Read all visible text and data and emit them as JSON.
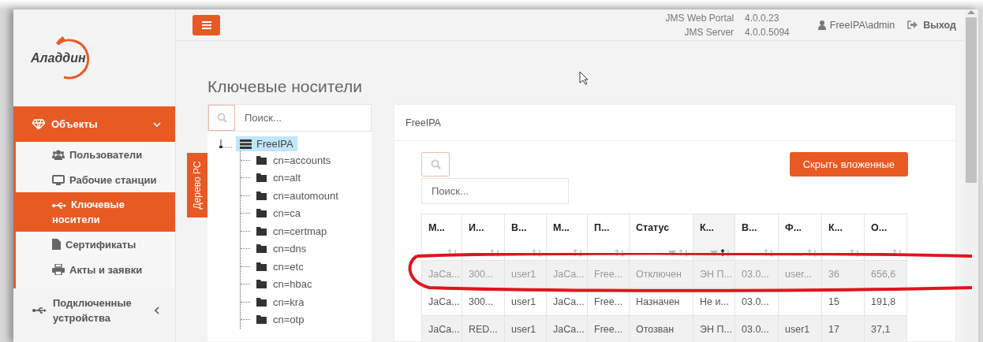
{
  "sidebar": {
    "logo": "Аладдин",
    "menu": [
      {
        "label": "Объекты",
        "expanded": true,
        "selected": true,
        "children": [
          {
            "label": "Пользователи",
            "selected": false
          },
          {
            "label": "Рабочие станции",
            "selected": false
          },
          {
            "label": "Ключевые носители",
            "selected": true
          },
          {
            "label": "Сертификаты",
            "selected": false
          },
          {
            "label": "Акты и заявки",
            "selected": false
          }
        ]
      },
      {
        "label": "Подключенные устройства",
        "expanded": false,
        "selected": false
      }
    ]
  },
  "topbar": {
    "versions": [
      {
        "name": "JMS Web Portal",
        "value": "4.0.0.23"
      },
      {
        "name": "JMS Server",
        "value": "4.0.0.5094"
      }
    ],
    "user": "FreeIPA\\admin",
    "logout": "Выход"
  },
  "page_title": "Ключевые носители",
  "tree_tab": "Дерево РС",
  "tree_search": {
    "placeholder": "Поиск..."
  },
  "tree": {
    "label": "FreeIPA",
    "selected": true,
    "expanded": true,
    "children": [
      {
        "label": "cn=accounts"
      },
      {
        "label": "cn=alt"
      },
      {
        "label": "cn=automount"
      },
      {
        "label": "cn=ca"
      },
      {
        "label": "cn=certmap"
      },
      {
        "label": "cn=dns"
      },
      {
        "label": "cn=etc"
      },
      {
        "label": "cn=hbac"
      },
      {
        "label": "cn=kra"
      },
      {
        "label": "cn=otp"
      }
    ]
  },
  "card": {
    "title": "FreeIPA",
    "search": {
      "placeholder": "Поиск..."
    },
    "hide_button": "Скрыть вложенные",
    "table": {
      "columns": [
        {
          "label": "М...",
          "sorted": false,
          "filter": false
        },
        {
          "label": "И...",
          "sorted": false,
          "filter": false
        },
        {
          "label": "В...",
          "sorted": false,
          "filter": false
        },
        {
          "label": "М...",
          "sorted": false,
          "filter": false
        },
        {
          "label": "П...",
          "sorted": false,
          "filter": false
        },
        {
          "label": "Статус",
          "sorted": false,
          "filter": true
        },
        {
          "label": "К...",
          "sorted": true,
          "filter": true
        },
        {
          "label": "В...",
          "sorted": false,
          "filter": false
        },
        {
          "label": "Ф...",
          "sorted": false,
          "filter": false
        },
        {
          "label": "К...",
          "sorted": false,
          "filter": false
        },
        {
          "label": "О...",
          "sorted": false,
          "filter": false
        }
      ],
      "rows": [
        {
          "disabled": true,
          "cells": [
            "JaCa...",
            "300...",
            "user1",
            "JaCa...",
            "Free...",
            "Отключен",
            "ЭН П...",
            "03.0...",
            "user...",
            "36",
            "656,6"
          ]
        },
        {
          "disabled": false,
          "cells": [
            "JaCa...",
            "300...",
            "user1",
            "JaCa...",
            "Free...",
            "Назначен",
            "Не и...",
            "03.0...",
            "",
            "15",
            "191,8"
          ]
        },
        {
          "disabled": false,
          "cells": [
            "JaCa...",
            "RED...",
            "user1",
            "JaCa...",
            "Free...",
            "Отозван",
            "ЭН П...",
            "03.0...",
            "user1",
            "17",
            "37,1"
          ]
        }
      ]
    }
  }
}
